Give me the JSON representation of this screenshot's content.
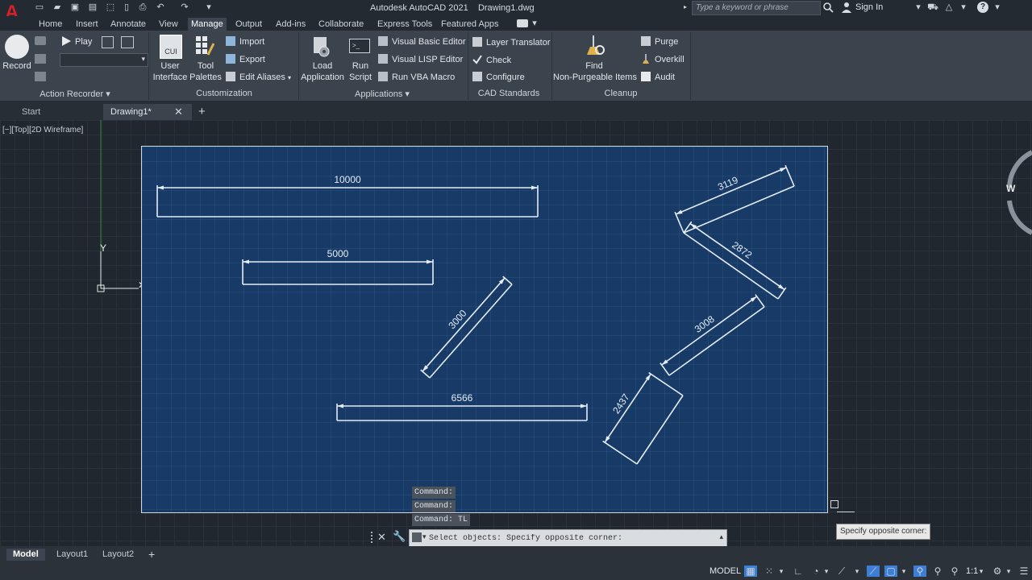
{
  "app": {
    "logo": "A",
    "title": "Autodesk AutoCAD 2021",
    "document": "Drawing1.dwg",
    "search_placeholder": "Type a keyword or phrase",
    "sign_in": "Sign In"
  },
  "ribbon_tabs": [
    "Home",
    "Insert",
    "Annotate",
    "View",
    "Manage",
    "Output",
    "Add-ins",
    "Collaborate",
    "Express Tools",
    "Featured Apps"
  ],
  "active_tab": "Manage",
  "action_recorder": {
    "record": "Record",
    "play": "Play",
    "panel": "Action Recorder"
  },
  "customization": {
    "cui_badge": "CUI",
    "user_interface": [
      "User",
      "Interface"
    ],
    "tool_palettes": [
      "Tool",
      "Palettes"
    ],
    "import": "Import",
    "export": "Export",
    "edit_aliases": "Edit Aliases",
    "panel": "Customization"
  },
  "applications": {
    "load_application": [
      "Load",
      "Application"
    ],
    "run_script": [
      "Run",
      "Script"
    ],
    "vb_editor": "Visual Basic Editor",
    "lisp_editor": "Visual LISP Editor",
    "run_vba": "Run VBA Macro",
    "panel": "Applications"
  },
  "cad_standards": {
    "layer_translator": "Layer Translator",
    "check": "Check",
    "configure": "Configure",
    "panel": "CAD Standards"
  },
  "cleanup": {
    "find": [
      "Find",
      "Non-Purgeable Items"
    ],
    "purge": "Purge",
    "overkill": "Overkill",
    "audit": "Audit",
    "panel": "Cleanup"
  },
  "doc_tabs": {
    "start": "Start",
    "drawing": "Drawing1*"
  },
  "viewport": {
    "label": "[−][Top][2D Wireframe]",
    "ucs_y": "Y",
    "viewcube_w": "W"
  },
  "dimensions": [
    "10000",
    "5000",
    "3000",
    "6566",
    "3119",
    "2872",
    "3008",
    "2437"
  ],
  "command": {
    "history": [
      "Command:",
      "Command:",
      "Command: TL"
    ],
    "prompt": "Select objects: Specify opposite corner:",
    "tooltip": "Specify opposite corner:"
  },
  "layout_tabs": [
    "Model",
    "Layout1",
    "Layout2"
  ],
  "status": {
    "model": "MODEL",
    "scale": "1:1"
  },
  "colors": {
    "paper": "#173a66",
    "dimension_line": "#e4ecf5",
    "ribbon": "#3b434c",
    "logo_red": "#d4202b"
  }
}
